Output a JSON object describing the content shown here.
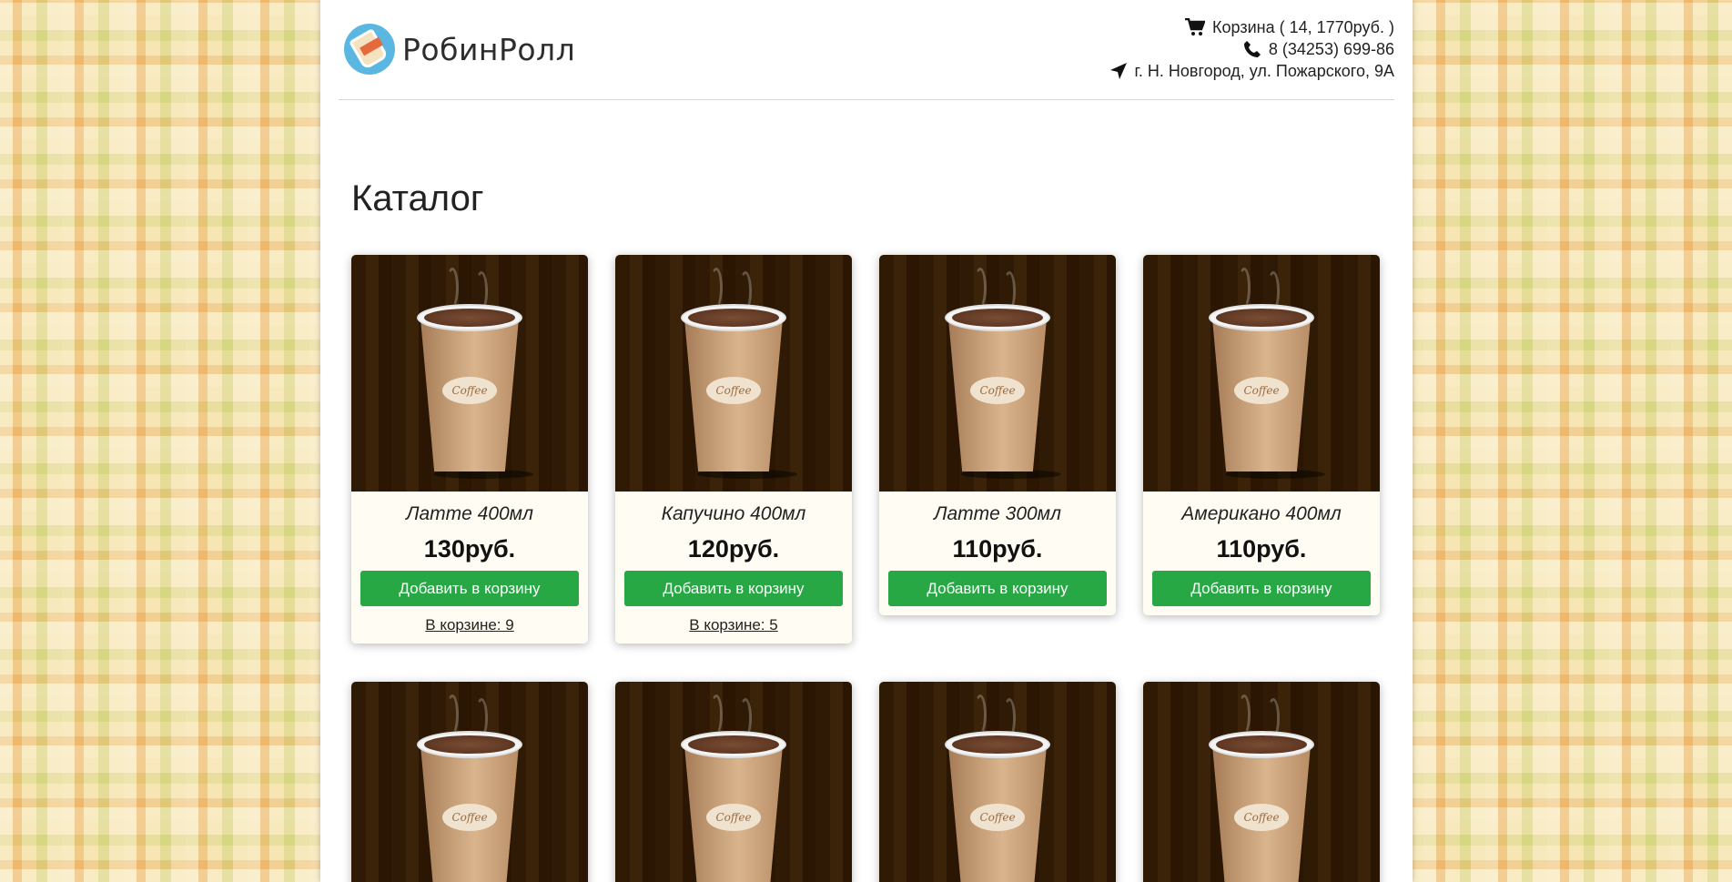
{
  "header": {
    "logo_text": "РобинРолл",
    "cart_text": "Корзина ( 14, 1770руб. )",
    "phone": "8 (34253) 699-86",
    "address": "г. Н. Новгород, ул. Пожарского, 9А"
  },
  "page_title": "Каталог",
  "colors": {
    "button_bg": "#28a745",
    "card_bg": "#fffdf3",
    "cup_background": "#2e1a05"
  },
  "products": [
    {
      "name": "Латте 400мл",
      "price": "130руб.",
      "button": "Добавить в корзину",
      "in_cart": "В корзине: 9",
      "image_label": "Coffee"
    },
    {
      "name": "Капучино 400мл",
      "price": "120руб.",
      "button": "Добавить в корзину",
      "in_cart": "В корзине: 5",
      "image_label": "Coffee"
    },
    {
      "name": "Латте 300мл",
      "price": "110руб.",
      "button": "Добавить в корзину",
      "in_cart": null,
      "image_label": "Coffee"
    },
    {
      "name": "Американо 400мл",
      "price": "110руб.",
      "button": "Добавить в корзину",
      "in_cart": null,
      "image_label": "Coffee"
    },
    {
      "image_label": "Coffee"
    },
    {
      "image_label": "Coffee"
    },
    {
      "image_label": "Coffee"
    },
    {
      "image_label": "Coffee"
    }
  ],
  "icons": {
    "cart": "shopping-cart-icon",
    "phone": "phone-icon",
    "location": "location-arrow-icon"
  }
}
